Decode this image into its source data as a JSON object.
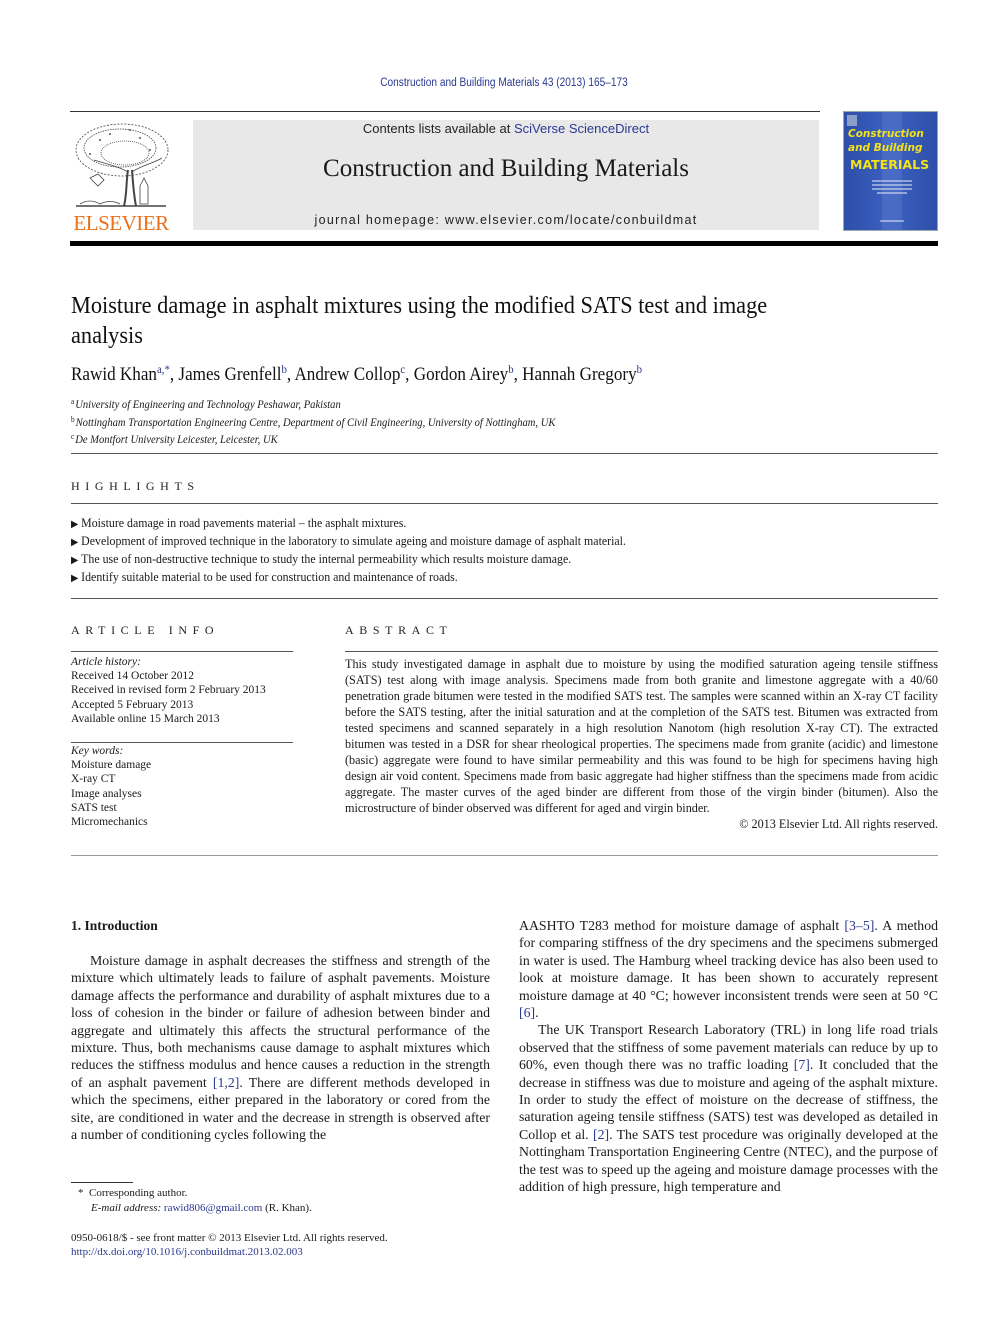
{
  "header": {
    "citation": "Construction and Building Materials 43 (2013) 165–173",
    "contents_prefix": "Contents lists available at ",
    "contents_link": "SciVerse ScienceDirect",
    "journal_name": "Construction and Building Materials",
    "homepage": "journal homepage: www.elsevier.com/locate/conbuildmat",
    "publisher_logo_text": "ELSEVIER",
    "cover": {
      "title_line1": "Construction",
      "title_line2": "and Building",
      "title_line3": "MATERIALS"
    }
  },
  "colors": {
    "link": "#2a3990",
    "elsevier_orange": "#e9711c",
    "masthead_gray": "#e8e8e8",
    "cover_blue": "#3a5fbf",
    "cover_yellow": "#f4e21a"
  },
  "article": {
    "title": "Moisture damage in asphalt mixtures using the modified SATS test and image analysis",
    "authors": [
      {
        "name": "Rawid Khan",
        "sup": "a,*"
      },
      {
        "name": "James Grenfell",
        "sup": "b"
      },
      {
        "name": "Andrew Collop",
        "sup": "c"
      },
      {
        "name": "Gordon Airey",
        "sup": "b"
      },
      {
        "name": "Hannah Gregory",
        "sup": "b"
      }
    ],
    "affiliations": [
      {
        "key": "a",
        "text": "University of Engineering and Technology Peshawar, Pakistan"
      },
      {
        "key": "b",
        "text": "Nottingham Transportation Engineering Centre, Department of Civil Engineering, University of Nottingham, UK"
      },
      {
        "key": "c",
        "text": "De Montfort University Leicester, Leicester, UK"
      }
    ]
  },
  "highlights": {
    "heading": "HIGHLIGHTS",
    "items": [
      "Moisture damage in road pavements material – the asphalt mixtures.",
      "Development of improved technique in the laboratory to simulate ageing and moisture damage of asphalt material.",
      "The use of non-destructive technique to study the internal permeability which results moisture damage.",
      "Identify suitable material to be used for construction and maintenance of roads."
    ]
  },
  "article_info": {
    "heading": "ARTICLE INFO",
    "history_label": "Article history:",
    "history": [
      "Received 14 October 2012",
      "Received in revised form 2 February 2013",
      "Accepted 5 February 2013",
      "Available online 15 March 2013"
    ],
    "keywords_label": "Key words:",
    "keywords": [
      "Moisture damage",
      "X-ray CT",
      "Image analyses",
      "SATS test",
      "Micromechanics"
    ]
  },
  "abstract": {
    "heading": "ABSTRACT",
    "text": "This study investigated damage in asphalt due to moisture by using the modified saturation ageing ten­sile stiffness (SATS) test along with image analysis. Specimens made from both granite and limestone aggregate with a 40/60 penetration grade bitumen were tested in the modified SATS test. The samples were scanned within an X-ray CT facility before the SATS testing, after the initial saturation and at the completion of the SATS test. Bitumen was extracted from tested specimens and scanned separately in a high resolution Nanotom (high resolution X-ray CT). The extracted bitumen was tested in a DSR for shear rheological properties. The specimens made from granite (acidic) and limestone (basic) aggregate were found to have similar permeability and this was found to be high for specimens having high design air void content. Specimens made from basic aggregate had higher stiffness than the specimens made from acidic aggregate. The master curves of the aged binder are different from those of the virgin binder (bitumen). Also the microstructure of binder observed was different for aged and virgin binder.",
    "copyright": "© 2013 Elsevier Ltd. All rights reserved."
  },
  "introduction": {
    "heading": "1. Introduction",
    "left_p1_a": "Moisture damage in asphalt decreases the stiffness and strength of the mixture which ultimately leads to failure of asphalt pave­ments. Moisture damage affects the performance and durability of asphalt mixtures due to a loss of cohesion in the binder or failure of adhesion between binder and aggregate and ultimately this af­fects the structural performance of the mixture. Thus, both mech­anisms cause damage to asphalt mixtures which reduces the stiffness modulus and hence causes a reduction in the strength of an asphalt pavement ",
    "left_ref1": "[1,2]",
    "left_p1_b": ". There are different methods developed in which the specimens, either prepared in the laboratory or cored from the site, are conditioned in water and the decrease in strength is observed after a number of conditioning cycles following the",
    "right_p1_a": "AASHTO T283 method for moisture damage of asphalt ",
    "right_ref1": "[3–5]",
    "right_p1_b": ". A method for comparing stiffness of the dry specimens and the spec­imens submerged in water is used. The Hamburg wheel tracking device has also been used to look at moisture damage. It has been shown to accurately represent moisture damage at 40 °C; however inconsistent trends were seen at 50 °C ",
    "right_ref2": "[6]",
    "right_p1_c": ".",
    "right_p2_a": "The UK Transport Research Laboratory (TRL) in long life road tri­als observed that the stiffness of some pavement materials can re­duce by up to 60%, even though there was no traffic loading ",
    "right_ref3": "[7]",
    "right_p2_b": ". It concluded that the decrease in stiffness was due to moisture and ageing of the asphalt mixture. In order to study the effect of mois­ture on the decrease of stiffness, the saturation ageing tensile stiff­ness (SATS) test was developed as detailed in Collop et al. ",
    "right_ref4": "[2]",
    "right_p2_c": ". The SATS test procedure was originally developed at the Nottingham Transportation Engineering Centre (NTEC), and the purpose of the test was to speed up the ageing and moisture damage pro­cesses with the addition of high pressure, high temperature and"
  },
  "footnotes": {
    "star": "*",
    "corresponding": "Corresponding author.",
    "email_label": "E-mail address:",
    "email": "rawid806@gmail.com",
    "email_suffix": " (R. Khan).",
    "issn_line": "0950-0618/$ - see front matter © 2013 Elsevier Ltd. All rights reserved.",
    "doi": "http://dx.doi.org/10.1016/j.conbuildmat.2013.02.003"
  }
}
